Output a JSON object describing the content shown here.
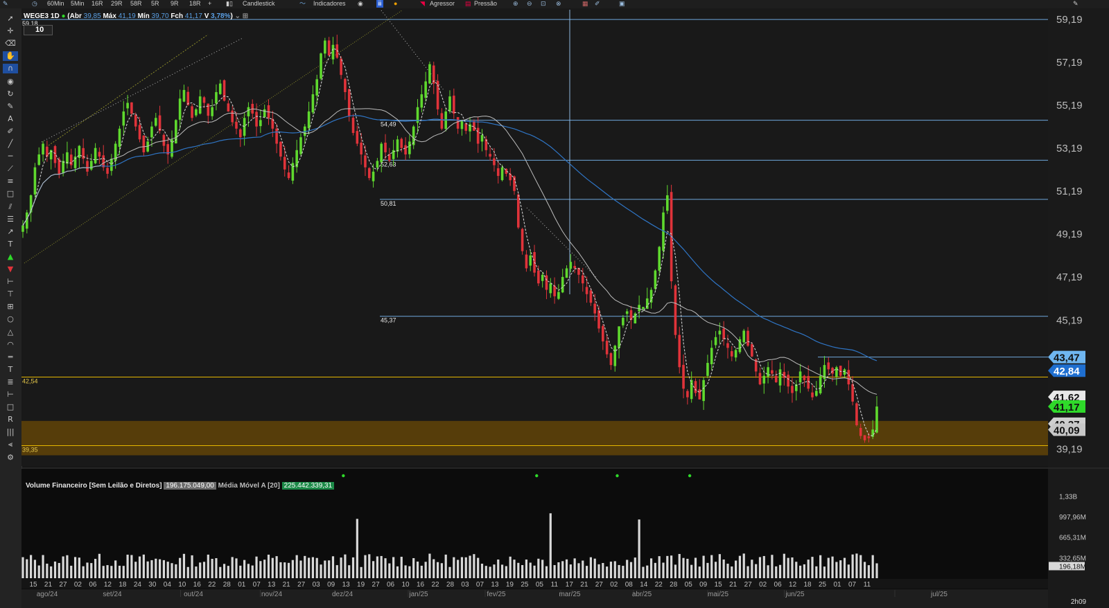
{
  "toolbar_top": {
    "intervals": [
      "60Min",
      "5Min",
      "16R",
      "29R",
      "58R",
      "5R",
      "9R",
      "18R",
      "+"
    ],
    "chart_type": "Candlestick",
    "indicators_label": "Indicadores",
    "agressor_label": "Agressor",
    "pressao_label": "Pressão"
  },
  "ticker": {
    "symbol": "WEGE3 1D",
    "open_label": "Abr",
    "open": "39,85",
    "high_label": "Máx",
    "high": "41,19",
    "low_label": "Mín",
    "low": "39,70",
    "close_label": "Fch",
    "close": "41,17",
    "var_label": "V",
    "var": "3,78%",
    "interval_box": "10"
  },
  "left_tools": [
    "arrow-icon",
    "crosshair-icon",
    "eraser-icon",
    "hand-icon",
    "magnet-icon",
    "eye-icon",
    "cursor-icon",
    "pen-icon",
    "text-a-icon",
    "brush-icon",
    "line-icon",
    "hline-icon",
    "ray-icon",
    "channel-icon",
    "rect-icon",
    "fib-icon",
    "lines-icon",
    "trend-icon",
    "text-icon",
    "up-arrow-icon",
    "down-arrow-icon",
    "measure-icon",
    "measure2-icon",
    "grid-icon",
    "circle-icon",
    "triangle-icon",
    "arc-icon",
    "dash-icon",
    "text2-icon",
    "list-icon",
    "ruler-icon",
    "square-icon",
    "r-icon",
    "bars-icon",
    "vol-icon",
    "settings-icon"
  ],
  "colors": {
    "up": "#5fd92e",
    "down": "#e0333a",
    "ma_short": "#cfcfcf",
    "ma_mid": "#bdbdbd",
    "ma_long": "#2f75c5",
    "hline": "#6fa8dc",
    "support": "#e6b800",
    "zone": "#5a3f0a"
  },
  "chart_data": [
    {
      "type": "candlestick",
      "title": "WEGE3 1D",
      "y_range": [
        38.4,
        59.7
      ],
      "y_ticks": [
        "59,19",
        "57,19",
        "55,19",
        "53,19",
        "51,19",
        "49,19",
        "47,19",
        "45,19",
        "39,19"
      ],
      "price_tags": [
        {
          "label": "43,47",
          "color": "#6fb6f0",
          "value": 43.47
        },
        {
          "label": "42,84",
          "color": "#1f6fd0",
          "value": 42.84
        },
        {
          "label": "41,62",
          "color": "#e8e8e8",
          "value": 41.62
        },
        {
          "label": "41,17",
          "color": "#2fd92a",
          "value": 41.17
        },
        {
          "label": "40,37",
          "color": "#d0d0d0",
          "value": 40.37
        },
        {
          "label": "40,09",
          "color": "#c8c8c8",
          "value": 40.09
        }
      ],
      "level_lines": [
        {
          "label": "59,18",
          "value": 59.18,
          "kind": "full"
        },
        {
          "label": "54,49",
          "value": 54.49,
          "kind": "partial"
        },
        {
          "label": "52,63",
          "value": 52.63,
          "kind": "partial"
        },
        {
          "label": "50,81",
          "value": 50.81,
          "kind": "partial"
        },
        {
          "label": "45,37",
          "value": 45.37,
          "kind": "partial"
        },
        {
          "label": "",
          "value": 43.47,
          "kind": "partial"
        },
        {
          "label": "42,54",
          "value": 42.54,
          "kind": "support"
        },
        {
          "label": "39,35",
          "value": 39.35,
          "kind": "support"
        }
      ],
      "zone": {
        "from": 38.9,
        "to": 40.5
      },
      "x_day_labels": [
        "15",
        "21",
        "27",
        "02",
        "06",
        "12",
        "18",
        "24",
        "30",
        "04",
        "10",
        "16",
        "22",
        "28",
        "01",
        "07",
        "13",
        "21",
        "27",
        "03",
        "09",
        "13",
        "19",
        "27",
        "06",
        "10",
        "16",
        "22",
        "28",
        "03",
        "07",
        "13",
        "19",
        "25",
        "05",
        "11",
        "17",
        "21",
        "27",
        "02",
        "08",
        "14",
        "22",
        "28",
        "05",
        "09",
        "15",
        "21",
        "27",
        "02",
        "06",
        "12",
        "18",
        "25",
        "01",
        "07",
        "11"
      ],
      "x_month_labels": [
        "ago/24",
        "set/24",
        "out/24",
        "nov/24",
        "dez/24",
        "jan/25",
        "fev/25",
        "mar/25",
        "abr/25",
        "mai/25",
        "jun/25",
        "jul/25"
      ],
      "close_series": [
        49.6,
        50.2,
        51.0,
        52.3,
        52.9,
        53.4,
        52.8,
        53.1,
        52.5,
        52.0,
        52.6,
        53.0,
        52.4,
        52.8,
        53.3,
        52.7,
        52.1,
        52.6,
        53.2,
        52.8,
        52.3,
        52.0,
        52.7,
        53.4,
        54.1,
        54.9,
        55.3,
        54.8,
        54.2,
        53.6,
        53.0,
        53.5,
        54.2,
        54.6,
        54.0,
        53.3,
        52.9,
        53.6,
        54.5,
        55.5,
        55.9,
        55.2,
        54.6,
        55.0,
        55.6,
        55.3,
        54.7,
        55.1,
        55.8,
        56.2,
        55.4,
        54.9,
        54.4,
        54.1,
        53.7,
        54.6,
        55.1,
        54.8,
        54.2,
        54.5,
        55.0,
        54.6,
        54.1,
        53.4,
        52.8,
        52.2,
        51.8,
        52.5,
        53.1,
        53.7,
        54.2,
        54.9,
        55.7,
        56.4,
        57.6,
        58.2,
        57.5,
        58.0,
        57.4,
        56.6,
        55.8,
        54.7,
        53.9,
        53.4,
        52.9,
        52.3,
        51.8,
        52.1,
        52.6,
        53.4,
        53.0,
        52.6,
        53.1,
        53.6,
        53.2,
        52.9,
        53.5,
        54.2,
        55.1,
        55.7,
        56.3,
        57.1,
        56.2,
        55.0,
        54.1,
        54.9,
        55.6,
        54.8,
        54.1,
        54.5,
        54.0,
        54.3,
        54.0,
        53.4,
        53.8,
        53.1,
        52.8,
        52.4,
        51.9,
        52.3,
        52.0,
        51.7,
        51.2,
        49.5,
        48.4,
        47.6,
        48.2,
        47.4,
        46.9,
        47.3,
        46.6,
        46.9,
        46.3,
        46.5,
        47.2,
        47.6,
        47.9,
        47.6,
        47.3,
        46.9,
        46.4,
        46.0,
        45.5,
        44.8,
        44.2,
        43.6,
        43.1,
        44.0,
        44.9,
        45.3,
        45.6,
        45.2,
        45.5,
        45.9,
        45.8,
        46.2,
        46.6,
        47.5,
        48.6,
        50.2,
        51.0,
        47.0,
        44.5,
        43.0,
        42.0,
        41.6,
        42.4,
        41.8,
        41.5,
        42.4,
        43.2,
        43.9,
        44.4,
        44.7,
        44.3,
        43.9,
        43.5,
        43.8,
        44.3,
        44.7,
        44.0,
        43.5,
        42.8,
        42.2,
        42.6,
        43.0,
        42.7,
        42.3,
        42.9,
        42.5,
        42.1,
        41.8,
        42.2,
        42.8,
        42.4,
        42.0,
        41.6,
        41.9,
        42.6,
        43.1,
        42.9,
        42.7,
        43.0,
        42.6,
        42.9,
        42.2,
        41.4,
        40.3,
        39.8,
        39.6,
        39.7,
        40.1,
        41.17
      ],
      "volume": {
        "title": "Volume Financeiro [Sem Leilão e Diretos]",
        "current": "196.175.049,00",
        "ma_label": "Média Móvel A [20]",
        "ma_value": "225.442.339,31",
        "y_ticks": [
          "1,33B",
          "997,96M",
          "665,31M",
          "332,65M",
          "196,18M"
        ],
        "y_range": [
          0,
          1.4
        ],
        "spikes": [
          {
            "index": 83,
            "value": 0.96
          },
          {
            "index": 131,
            "value": 1.05
          },
          {
            "index": 153,
            "value": 0.95
          },
          {
            "index": 220,
            "value": 1.32
          },
          {
            "index": 222,
            "value": 0.55
          }
        ]
      }
    }
  ],
  "timer": "2h09"
}
